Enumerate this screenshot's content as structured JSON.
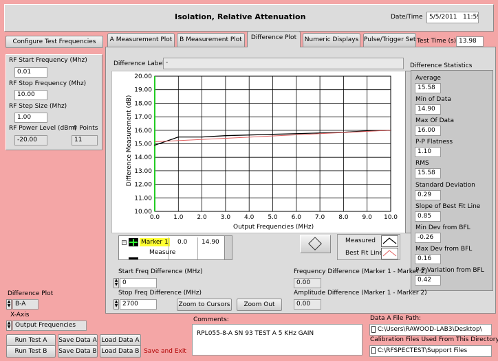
{
  "window": {
    "title": "Isolation, Relative Attenuation",
    "datetime_label": "Date/Time",
    "date": "5/5/2011",
    "time": "11:59"
  },
  "config_button": "Configure Test Frequencies",
  "rf": {
    "start_label": "RF Start Frequency (Mhz)",
    "start_value": "0.01",
    "stop_label": "RF Stop Frequency (Mhz)",
    "stop_value": "10.00",
    "step_label": "RF Step Size (Mhz)",
    "step_value": "1.00",
    "power_label": "RF Power Level (dBm)",
    "power_value": "-20.00",
    "points_label": "# Points",
    "points_value": "11"
  },
  "tabs": [
    "A Measurement Plot",
    "B Measurement Plot",
    "Difference Plot",
    "Numeric Displays",
    "Pulse/Trigger Settings"
  ],
  "test_time": {
    "label": "Test Time (s)",
    "value": "13.98"
  },
  "difference_label": {
    "label": "Difference Label",
    "value": "-"
  },
  "stats": {
    "title": "Difference Statistics",
    "items": [
      {
        "label": "Average",
        "value": "15.58"
      },
      {
        "label": "Min of Data",
        "value": "14.90"
      },
      {
        "label": "Max Of Data",
        "value": "16.00"
      },
      {
        "label": "P-P Flatness",
        "value": "1.10"
      },
      {
        "label": "RMS",
        "value": "15.58"
      },
      {
        "label": "Standard Deviation",
        "value": "0.29"
      },
      {
        "label": "Slope of Best Fit Line",
        "value": "0.85"
      },
      {
        "label": "Min Dev from BFL",
        "value": "-0.26"
      },
      {
        "label": "Max Dev from BFL",
        "value": "0.16"
      },
      {
        "label": "P-P Variation from BFL",
        "value": "0.42"
      }
    ]
  },
  "chart_data": {
    "type": "line",
    "xlabel": "Output Frequencies (MHz)",
    "ylabel": "Difference Measurement (dB)",
    "xlim": [
      0,
      10
    ],
    "ylim": [
      10,
      20
    ],
    "xticks": [
      "0.0",
      "1.0",
      "2.0",
      "3.0",
      "4.0",
      "5.0",
      "6.0",
      "7.0",
      "8.0",
      "9.0",
      "10.0"
    ],
    "yticks": [
      "10.00",
      "11.00",
      "12.00",
      "13.00",
      "14.00",
      "15.00",
      "16.00",
      "17.00",
      "18.00",
      "19.00",
      "20.00"
    ],
    "grid": true,
    "series": [
      {
        "name": "Measured",
        "color": "#000000",
        "x": [
          0,
          1,
          2,
          3,
          4,
          5,
          6,
          7,
          8,
          9,
          10
        ],
        "y": [
          14.9,
          15.5,
          15.5,
          15.6,
          15.65,
          15.7,
          15.75,
          15.8,
          15.85,
          15.95,
          16.0
        ]
      },
      {
        "name": "Best Fit Line",
        "color": "#e06060",
        "x": [
          0,
          10
        ],
        "y": [
          15.15,
          16.0
        ]
      }
    ]
  },
  "marker_table": {
    "rows": [
      {
        "name": "Marker 1",
        "x": "0.0",
        "y": "14.90"
      },
      {
        "name": "Measure",
        "x": "",
        "y": ""
      }
    ]
  },
  "legend": {
    "measured": "Measured",
    "bestfit": "Best Fit Line"
  },
  "controls": {
    "start_freq_diff_label": "Start Freq Difference (MHz)",
    "start_freq_diff_value": "0",
    "stop_freq_diff_label": "Stop Freq Difference (MHz)",
    "stop_freq_diff_value": "2700",
    "zoom_cursors": "Zoom to Cursors",
    "zoom_out": "Zoom Out",
    "freq_diff_label": "Frequency Difference (Marker 1 - Marker 2)",
    "freq_diff_value": "0.00",
    "amp_diff_label": "Amplitude Difference (Marker 1 - Marker 2)",
    "amp_diff_value": "0.00"
  },
  "left_bottom": {
    "diff_plot_label": "Difference Plot",
    "diff_plot_value": "B-A",
    "xaxis_label": "X-Axis",
    "xaxis_value": "Output Frequencies"
  },
  "buttons": {
    "run_a": "Run Test A",
    "save_a": "Save Data A",
    "load_a": "Load Data A",
    "run_b": "Run Test B",
    "save_b": "Save Data B",
    "load_b": "Load Data B",
    "save_exit": "Save and Exit"
  },
  "comments": {
    "label": "Comments:",
    "value": "RPL055-8-A SN 93 TEST A 5 KHz GAIN"
  },
  "files": {
    "a_label": "Data A File Path:",
    "a_value": "C:\\Users\\RAWOOD-LAB3\\Desktop\\",
    "cal_label": "Calibration Files Used From This Directory:",
    "cal_value": "C:\\RFSPECTEST\\Support Files"
  }
}
